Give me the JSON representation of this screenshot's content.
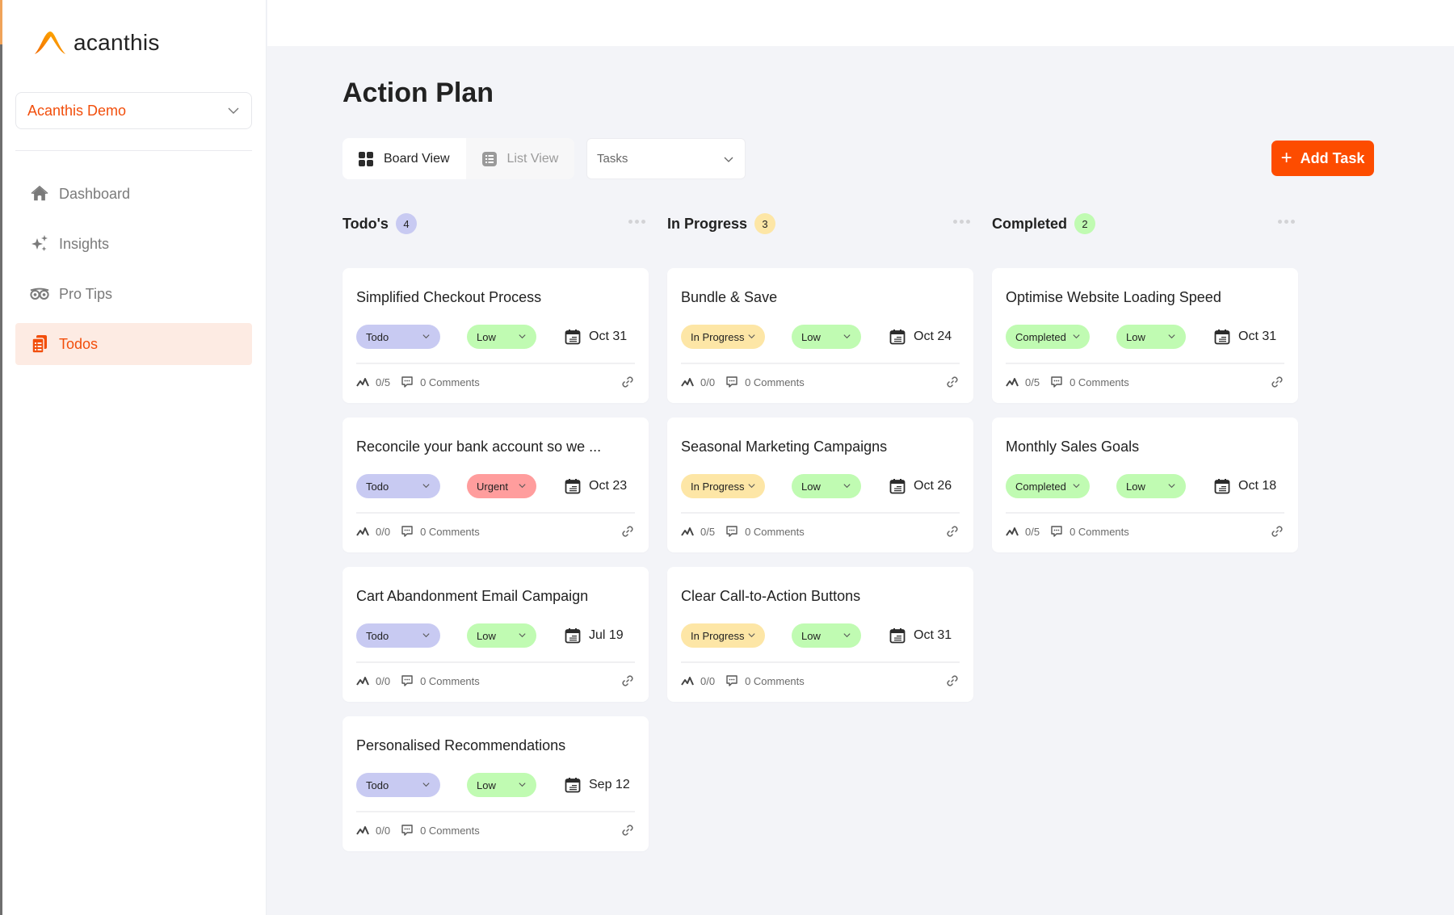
{
  "app": {
    "brand": "acanthis"
  },
  "sidebar": {
    "org_selector": {
      "value": "Acanthis Demo"
    },
    "items": [
      {
        "label": "Dashboard",
        "icon": "home-icon",
        "active": false
      },
      {
        "label": "Insights",
        "icon": "sparkles-icon",
        "active": false
      },
      {
        "label": "Pro Tips",
        "icon": "owl-icon",
        "active": false
      },
      {
        "label": "Todos",
        "icon": "clipboard-list-icon",
        "active": true
      }
    ]
  },
  "main": {
    "title": "Action Plan",
    "views": [
      {
        "label": "Board View",
        "icon": "grid-icon",
        "active": true
      },
      {
        "label": "List View",
        "icon": "list-icon",
        "active": false
      }
    ],
    "filter": {
      "value": "Tasks"
    },
    "add_task_label": "Add Task"
  },
  "colors": {
    "accent": "#fd4c00",
    "todo": "#c8caf2",
    "in_progress": "#fde6a6",
    "completed": "#c0fbb2",
    "low": "#c0fbb2",
    "urgent": "#ff9d9d"
  },
  "columns": [
    {
      "title": "Todo's",
      "count": "4",
      "count_color": "#c8caf2",
      "cards": [
        {
          "title": "Simplified Checkout Process",
          "status": "Todo",
          "priority": "Low",
          "due": "Oct 31",
          "subtasks": "0/5",
          "comments": "0 Comments"
        },
        {
          "title": "Reconcile your bank account so we ...",
          "status": "Todo",
          "priority": "Urgent",
          "due": "Oct 23",
          "subtasks": "0/0",
          "comments": "0 Comments"
        },
        {
          "title": "Cart Abandonment Email Campaign",
          "status": "Todo",
          "priority": "Low",
          "due": "Jul 19",
          "subtasks": "0/0",
          "comments": "0 Comments"
        },
        {
          "title": "Personalised Recommendations",
          "status": "Todo",
          "priority": "Low",
          "due": "Sep 12",
          "subtasks": "0/0",
          "comments": "0 Comments"
        }
      ]
    },
    {
      "title": "In Progress",
      "count": "3",
      "count_color": "#fde6a6",
      "cards": [
        {
          "title": "Bundle & Save",
          "status": "In Progress",
          "priority": "Low",
          "due": "Oct 24",
          "subtasks": "0/0",
          "comments": "0 Comments"
        },
        {
          "title": "Seasonal Marketing Campaigns",
          "status": "In Progress",
          "priority": "Low",
          "due": "Oct 26",
          "subtasks": "0/5",
          "comments": "0 Comments"
        },
        {
          "title": "Clear Call-to-Action Buttons",
          "status": "In Progress",
          "priority": "Low",
          "due": "Oct 31",
          "subtasks": "0/0",
          "comments": "0 Comments"
        }
      ]
    },
    {
      "title": "Completed",
      "count": "2",
      "count_color": "#c0fbb2",
      "cards": [
        {
          "title": "Optimise Website Loading Speed",
          "status": "Completed",
          "priority": "Low",
          "due": "Oct 31",
          "subtasks": "0/5",
          "comments": "0 Comments"
        },
        {
          "title": "Monthly Sales Goals",
          "status": "Completed",
          "priority": "Low",
          "due": "Oct 18",
          "subtasks": "0/5",
          "comments": "0 Comments"
        }
      ]
    }
  ]
}
